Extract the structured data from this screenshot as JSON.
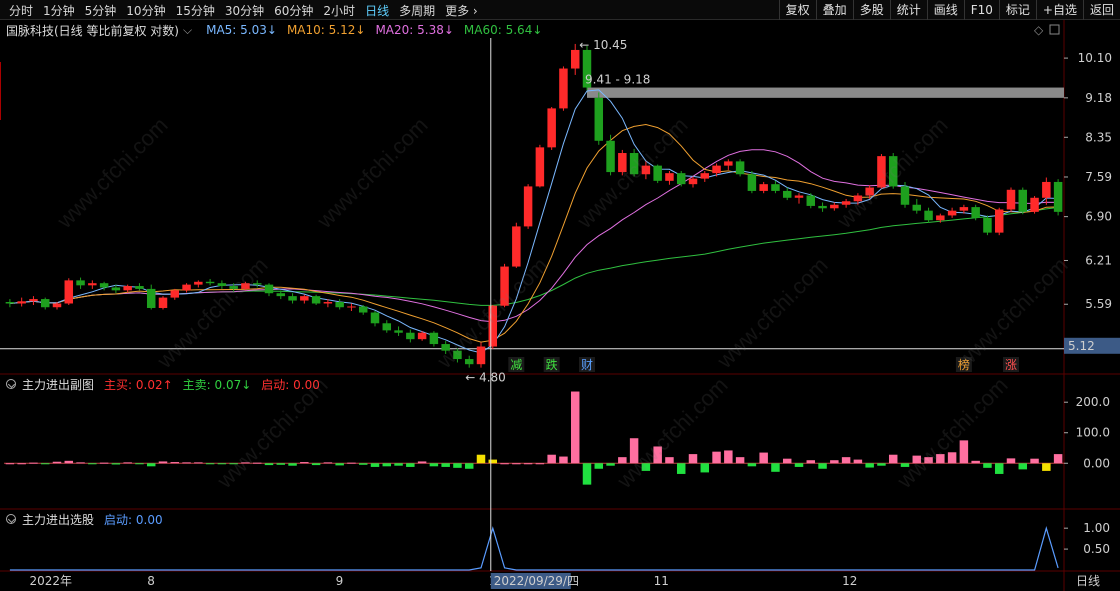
{
  "toolbar": {
    "periods": [
      "分时",
      "1分钟",
      "5分钟",
      "10分钟",
      "15分钟",
      "30分钟",
      "60分钟",
      "2小时",
      "日线",
      "多周期",
      "更多"
    ],
    "active_period": "日线",
    "tools": [
      "复权",
      "叠加",
      "多股",
      "统计",
      "画线",
      "F10",
      "标记",
      "+自选",
      "返回"
    ]
  },
  "main_legend": {
    "title": "国脉科技(日线 等比前复权 对数)",
    "ma": [
      {
        "label": "MA5: 5.03",
        "color": "#7ab8ff",
        "arrow": "↓"
      },
      {
        "label": "MA10: 5.12",
        "color": "#f0a030",
        "arrow": "↓"
      },
      {
        "label": "MA20: 5.38",
        "color": "#e070e0",
        "arrow": "↓"
      },
      {
        "label": "MA60: 5.64",
        "color": "#30c040",
        "arrow": "↓"
      }
    ]
  },
  "sub1_legend": {
    "title": "主力进出副图",
    "items": [
      {
        "label": "主买: 0.02",
        "color": "#ff3030",
        "arrow": "↑"
      },
      {
        "label": "主卖: 0.07",
        "color": "#30d040",
        "arrow": "↓"
      },
      {
        "label": "启动: 0.00",
        "color": "#ff3030",
        "arrow": ""
      }
    ]
  },
  "sub2_legend": {
    "title": "主力进出选股",
    "items": [
      {
        "label": "启动: 0.00",
        "color": "#5a9cff",
        "arrow": ""
      }
    ]
  },
  "watermark": "www.cfchi.com",
  "colors": {
    "up": "#ff2a2a",
    "down": "#1ea01e",
    "ma5": "#7ab8ff",
    "ma10": "#f0a030",
    "ma20": "#e070e0",
    "ma60": "#30c040",
    "pink": "#ff6fa0",
    "green": "#20e040",
    "yellow": "#f5e000",
    "blue": "#5a9cff",
    "grid": "#3a0000"
  },
  "chart_data": {
    "type": "candlestick",
    "y_axis_labels": [
      "10.10",
      "9.18",
      "8.35",
      "7.59",
      "6.90",
      "6.21",
      "5.59",
      "5.03"
    ],
    "ylim": [
      4.75,
      10.6
    ],
    "price_marker": "5.12",
    "annotations": {
      "high": "10.45",
      "low": "4.80",
      "gap_label": "9.41 - 9.18",
      "gap_range": [
        9.18,
        9.41
      ]
    },
    "event_tags": [
      {
        "text": "减",
        "color": "#40e040",
        "day": 43
      },
      {
        "text": "跌",
        "color": "#40e040",
        "day": 46
      },
      {
        "text": "财",
        "color": "#5aa0ff",
        "day": 49
      },
      {
        "text": "榜",
        "color": "#f0a030",
        "day": 81
      },
      {
        "text": "涨",
        "color": "#ff5050",
        "day": 85
      }
    ],
    "x_axis_labels": [
      {
        "text": "2022年",
        "day": 2
      },
      {
        "text": "8",
        "day": 12
      },
      {
        "text": "9",
        "day": 28
      },
      {
        "text": "10",
        "day": 41
      },
      {
        "text": "11",
        "day": 55
      },
      {
        "text": "12",
        "day": 71
      }
    ],
    "crosshair_date": "2022/09/29/四",
    "crosshair_day": 41,
    "period_label": "日线",
    "sub1_y_labels": [
      "200.0",
      "100.0",
      "0.00"
    ],
    "sub1_ylim": [
      -140,
      240
    ],
    "sub2_y_labels": [
      "1.00",
      "0.50"
    ],
    "sub2_ylim": [
      0,
      1.1
    ],
    "ohlc": [
      [
        5.62,
        5.66,
        5.55,
        5.6
      ],
      [
        5.6,
        5.68,
        5.56,
        5.63
      ],
      [
        5.63,
        5.7,
        5.58,
        5.66
      ],
      [
        5.66,
        5.68,
        5.52,
        5.55
      ],
      [
        5.55,
        5.62,
        5.52,
        5.6
      ],
      [
        5.6,
        5.95,
        5.58,
        5.92
      ],
      [
        5.92,
        5.96,
        5.8,
        5.85
      ],
      [
        5.85,
        5.92,
        5.8,
        5.88
      ],
      [
        5.88,
        5.9,
        5.78,
        5.82
      ],
      [
        5.82,
        5.86,
        5.74,
        5.78
      ],
      [
        5.78,
        5.86,
        5.75,
        5.84
      ],
      [
        5.84,
        5.88,
        5.78,
        5.8
      ],
      [
        5.8,
        5.86,
        5.52,
        5.54
      ],
      [
        5.54,
        5.7,
        5.52,
        5.68
      ],
      [
        5.68,
        5.8,
        5.65,
        5.78
      ],
      [
        5.78,
        5.88,
        5.75,
        5.86
      ],
      [
        5.86,
        5.92,
        5.82,
        5.9
      ],
      [
        5.9,
        5.94,
        5.85,
        5.88
      ],
      [
        5.88,
        5.92,
        5.8,
        5.84
      ],
      [
        5.84,
        5.88,
        5.76,
        5.8
      ],
      [
        5.8,
        5.9,
        5.78,
        5.88
      ],
      [
        5.88,
        5.92,
        5.82,
        5.86
      ],
      [
        5.86,
        5.88,
        5.7,
        5.74
      ],
      [
        5.74,
        5.78,
        5.66,
        5.7
      ],
      [
        5.7,
        5.74,
        5.6,
        5.64
      ],
      [
        5.64,
        5.72,
        5.6,
        5.7
      ],
      [
        5.7,
        5.72,
        5.58,
        5.6
      ],
      [
        5.6,
        5.66,
        5.55,
        5.62
      ],
      [
        5.62,
        5.66,
        5.52,
        5.55
      ],
      [
        5.55,
        5.6,
        5.5,
        5.56
      ],
      [
        5.56,
        5.58,
        5.45,
        5.48
      ],
      [
        5.48,
        5.5,
        5.3,
        5.34
      ],
      [
        5.34,
        5.38,
        5.22,
        5.25
      ],
      [
        5.25,
        5.3,
        5.18,
        5.22
      ],
      [
        5.22,
        5.26,
        5.1,
        5.14
      ],
      [
        5.14,
        5.24,
        5.12,
        5.22
      ],
      [
        5.22,
        5.24,
        5.05,
        5.08
      ],
      [
        5.08,
        5.12,
        4.96,
        5.0
      ],
      [
        5.0,
        5.03,
        4.86,
        4.9
      ],
      [
        4.9,
        4.94,
        4.8,
        4.84
      ],
      [
        4.84,
        5.1,
        4.8,
        5.05
      ],
      [
        5.05,
        5.58,
        5.02,
        5.57
      ],
      [
        5.57,
        6.16,
        5.55,
        6.12
      ],
      [
        6.12,
        6.8,
        6.1,
        6.74
      ],
      [
        6.74,
        7.46,
        6.7,
        7.42
      ],
      [
        7.42,
        8.2,
        7.4,
        8.15
      ],
      [
        8.15,
        8.98,
        8.1,
        8.95
      ],
      [
        8.95,
        9.9,
        8.9,
        9.85
      ],
      [
        9.85,
        10.45,
        9.7,
        10.3
      ],
      [
        10.3,
        10.4,
        9.35,
        9.41
      ],
      [
        9.18,
        9.3,
        8.2,
        8.28
      ],
      [
        8.28,
        8.4,
        7.62,
        7.68
      ],
      [
        7.68,
        8.1,
        7.62,
        8.04
      ],
      [
        8.04,
        8.12,
        7.6,
        7.64
      ],
      [
        7.64,
        7.88,
        7.55,
        7.8
      ],
      [
        7.8,
        7.82,
        7.48,
        7.52
      ],
      [
        7.52,
        7.7,
        7.45,
        7.66
      ],
      [
        7.66,
        7.7,
        7.42,
        7.46
      ],
      [
        7.46,
        7.6,
        7.4,
        7.56
      ],
      [
        7.56,
        7.7,
        7.5,
        7.66
      ],
      [
        7.66,
        7.84,
        7.6,
        7.8
      ],
      [
        7.8,
        7.92,
        7.72,
        7.88
      ],
      [
        7.88,
        7.92,
        7.6,
        7.64
      ],
      [
        7.64,
        7.7,
        7.3,
        7.34
      ],
      [
        7.34,
        7.5,
        7.3,
        7.46
      ],
      [
        7.46,
        7.52,
        7.3,
        7.34
      ],
      [
        7.34,
        7.4,
        7.18,
        7.22
      ],
      [
        7.22,
        7.3,
        7.12,
        7.26
      ],
      [
        7.26,
        7.3,
        7.04,
        7.08
      ],
      [
        7.08,
        7.14,
        6.98,
        7.04
      ],
      [
        7.04,
        7.14,
        7.0,
        7.1
      ],
      [
        7.1,
        7.2,
        7.05,
        7.16
      ],
      [
        7.16,
        7.3,
        7.1,
        7.26
      ],
      [
        7.26,
        7.44,
        7.2,
        7.4
      ],
      [
        7.4,
        8.02,
        7.38,
        7.98
      ],
      [
        7.98,
        8.04,
        7.38,
        7.42
      ],
      [
        7.42,
        7.5,
        7.05,
        7.1
      ],
      [
        7.1,
        7.2,
        6.95,
        7.0
      ],
      [
        7.0,
        7.05,
        6.8,
        6.84
      ],
      [
        6.84,
        6.95,
        6.8,
        6.92
      ],
      [
        6.92,
        7.05,
        6.88,
        7.0
      ],
      [
        7.0,
        7.1,
        6.95,
        7.06
      ],
      [
        7.06,
        7.1,
        6.84,
        6.88
      ],
      [
        6.88,
        6.92,
        6.6,
        6.64
      ],
      [
        6.64,
        7.05,
        6.6,
        7.02
      ],
      [
        7.02,
        7.4,
        6.98,
        7.36
      ],
      [
        7.36,
        7.4,
        6.94,
        6.98
      ],
      [
        6.98,
        7.25,
        6.95,
        7.22
      ],
      [
        7.22,
        7.58,
        7.1,
        7.5
      ],
      [
        7.5,
        7.55,
        6.92,
        6.98
      ]
    ],
    "main_force": [
      0,
      0,
      2,
      -3,
      5,
      8,
      3,
      -2,
      2,
      -4,
      3,
      -3,
      -10,
      6,
      4,
      3,
      3,
      -2,
      -3,
      -3,
      3,
      2,
      -6,
      -5,
      -8,
      4,
      -6,
      3,
      -7,
      2,
      -5,
      -12,
      -10,
      -8,
      -12,
      6,
      -10,
      -12,
      -15,
      -18,
      28,
      12,
      0,
      0,
      0,
      0,
      28,
      22,
      235,
      -70,
      -18,
      -8,
      20,
      82,
      -25,
      55,
      20,
      -35,
      30,
      -30,
      38,
      42,
      20,
      -10,
      35,
      -28,
      15,
      -12,
      10,
      -18,
      10,
      20,
      12,
      -14,
      -8,
      28,
      -12,
      25,
      20,
      30,
      36,
      75,
      8,
      -15,
      -35,
      16,
      -20,
      15,
      -25,
      30,
      10,
      25,
      -8,
      -30,
      125,
      -38,
      -14,
      48,
      -18,
      -40,
      -12,
      55
    ],
    "signal": [
      0,
      0,
      0,
      0,
      0,
      0,
      0,
      0,
      0,
      0,
      0,
      0,
      0,
      0,
      0,
      0,
      0,
      0,
      0,
      0,
      0,
      0,
      0,
      0,
      0,
      0,
      0,
      0,
      0,
      0,
      0,
      0,
      0,
      0,
      0,
      0,
      0,
      0,
      0,
      0,
      0.05,
      1.0,
      0.05,
      0,
      0,
      0,
      0,
      0,
      0,
      0,
      0,
      0,
      0,
      0,
      0,
      0,
      0,
      0,
      0,
      0,
      0,
      0,
      0,
      0,
      0,
      0,
      0,
      0,
      0,
      0,
      0,
      0,
      0,
      0,
      0,
      0,
      0,
      0,
      0,
      0,
      0,
      0,
      0,
      0,
      0,
      0,
      0,
      0,
      1.0,
      0.05,
      0,
      0,
      0,
      0.05,
      1.0
    ]
  }
}
